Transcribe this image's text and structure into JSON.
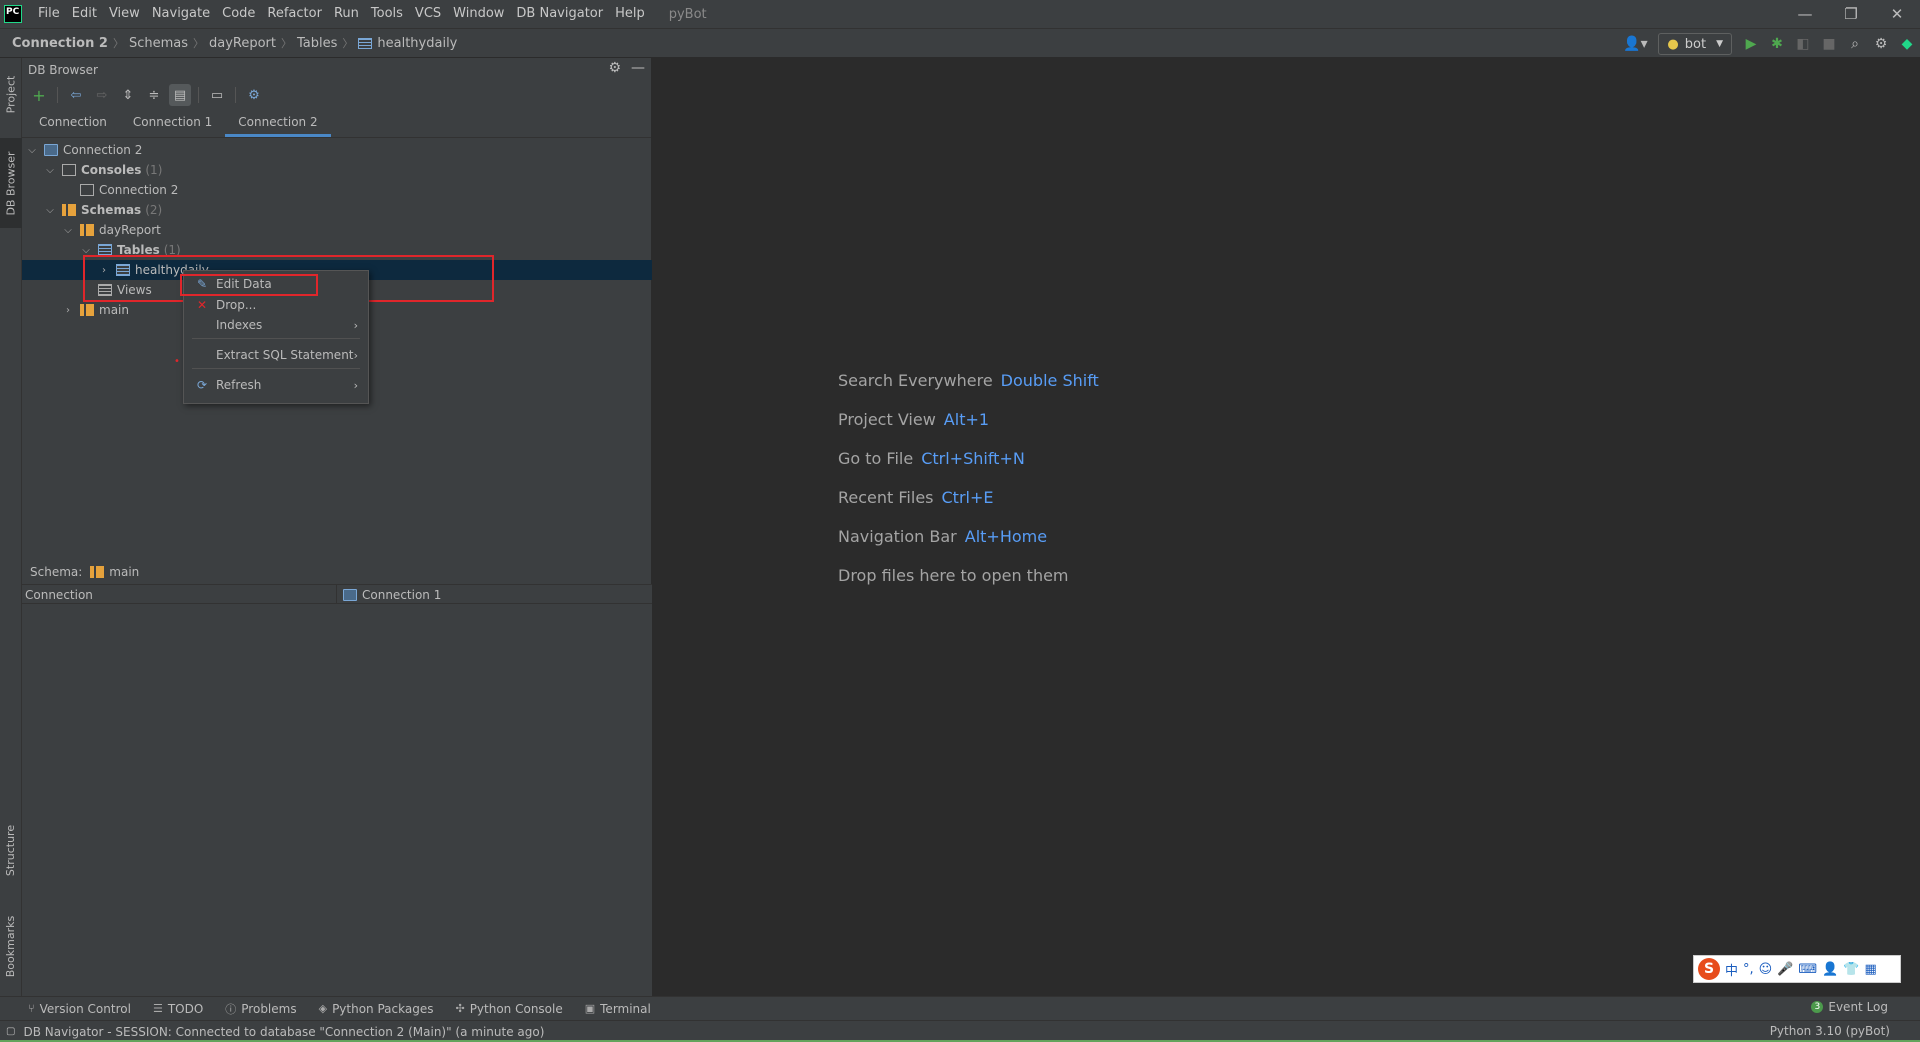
{
  "app": {
    "logo": "PC",
    "project": "pyBot"
  },
  "menu": [
    "File",
    "Edit",
    "View",
    "Navigate",
    "Code",
    "Refactor",
    "Run",
    "Tools",
    "VCS",
    "Window",
    "DB Navigator",
    "Help"
  ],
  "window_controls": {
    "minimize": "—",
    "restore": "❐",
    "close": "✕"
  },
  "breadcrumb": [
    "Connection 2",
    "Schemas",
    "dayReport",
    "Tables",
    "healthydaily"
  ],
  "run_config": {
    "label": "bot"
  },
  "left_stripe": {
    "project": "Project",
    "db_browser": "DB Browser",
    "structure": "Structure",
    "bookmarks": "Bookmarks"
  },
  "panel": {
    "title": "DB Browser",
    "tabs": [
      "Connection",
      "Connection 1",
      "Connection 2"
    ],
    "active_tab": "Connection 2"
  },
  "tree": {
    "connection": "Connection 2",
    "consoles": {
      "label": "Consoles",
      "count": "(1)"
    },
    "console_item": "Connection 2",
    "schemas": {
      "label": "Schemas",
      "count": "(2)"
    },
    "dayreport": "dayReport",
    "tables": {
      "label": "Tables",
      "count": "(1)"
    },
    "table_item": "healthydaily",
    "views": "Views",
    "main": "main"
  },
  "context_menu": {
    "edit_data": "Edit Data",
    "drop": "Drop...",
    "indexes": "Indexes",
    "extract_sql": "Extract SQL Statement",
    "refresh": "Refresh"
  },
  "schema_selector": {
    "label": "Schema:",
    "value": "main"
  },
  "grid": {
    "col1": "Connection",
    "col2": "Connection 1"
  },
  "editor_hints": [
    {
      "text": "Search Everywhere",
      "key": "Double Shift"
    },
    {
      "text": "Project View",
      "key": "Alt+1"
    },
    {
      "text": "Go to File",
      "key": "Ctrl+Shift+N"
    },
    {
      "text": "Recent Files",
      "key": "Ctrl+E"
    },
    {
      "text": "Navigation Bar",
      "key": "Alt+Home"
    },
    {
      "text": "Drop files here to open them",
      "key": ""
    }
  ],
  "ime": {
    "logo": "S",
    "lang": "中"
  },
  "bottom_tabs": [
    "Version Control",
    "TODO",
    "Problems",
    "Python Packages",
    "Python Console",
    "Terminal"
  ],
  "event_log": {
    "badge": "3",
    "label": "Event Log"
  },
  "status": {
    "message": "DB Navigator - SESSION: Connected to database \"Connection 2 (Main)\" (a minute ago)",
    "interpreter": "Python 3.10 (pyBot)"
  },
  "colors": {
    "accent": "#4a88c7",
    "selection": "#0d293e",
    "highlight_box": "#e0262b",
    "shortcut": "#589df6"
  }
}
